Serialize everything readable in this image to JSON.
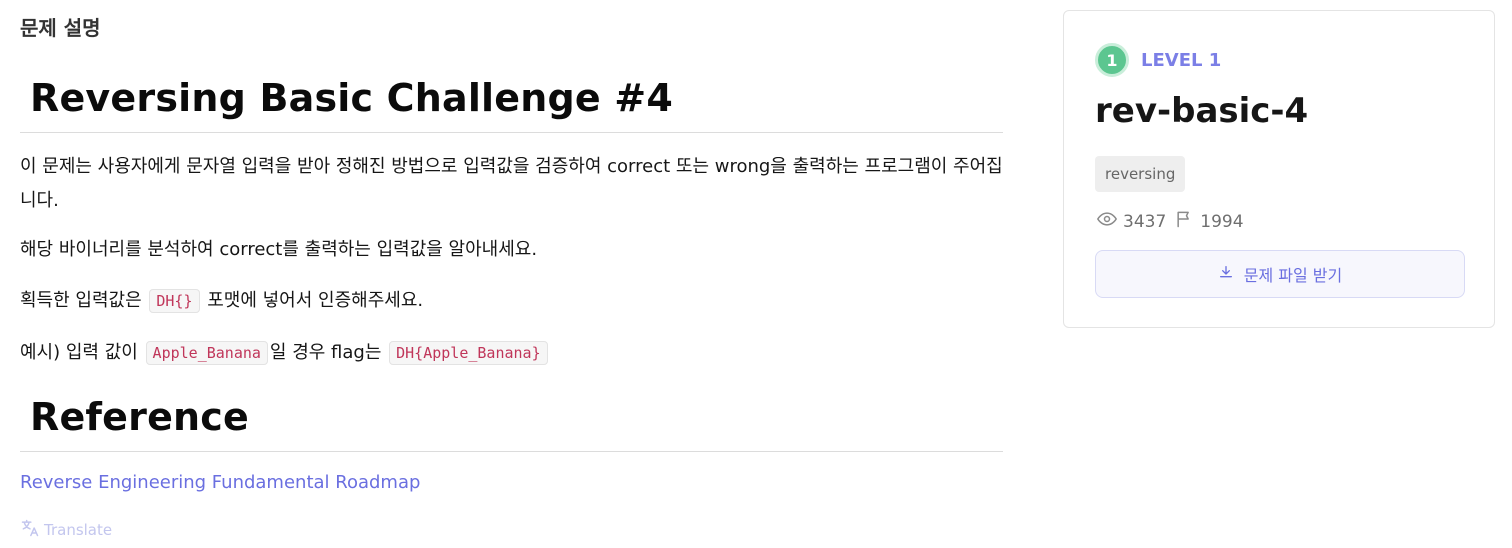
{
  "section": {
    "label": "문제 설명"
  },
  "content": {
    "title": "Reversing Basic Challenge #4",
    "p1": "이 문제는 사용자에게 문자열 입력을 받아 정해진 방법으로 입력값을 검증하여 correct 또는 wrong을 출력하는 프로그램이 주어집니다.",
    "p2": "해당 바이너리를 분석하여 correct를 출력하는 입력값을 알아내세요.",
    "p3_before": "획득한 입력값은 ",
    "p3_code": "DH{}",
    "p3_after": " 포맷에 넣어서 인증해주세요.",
    "p4_before": "예시) 입력 값이 ",
    "p4_code1": "Apple_Banana",
    "p4_mid": "일 경우 flag는 ",
    "p4_code2": "DH{Apple_Banana}",
    "reference_heading": "Reference",
    "reference_link": "Reverse Engineering Fundamental Roadmap",
    "translate_label": "Translate"
  },
  "card": {
    "level_number": "1",
    "level_label": "LEVEL 1",
    "title": "rev-basic-4",
    "tag": "reversing",
    "views": "3437",
    "solves": "1994",
    "download_label": "문제 파일 받기"
  },
  "colors": {
    "accent": "#6a6fe0",
    "level_green": "#5cc690",
    "code_red": "#c0365a"
  },
  "icons": [
    "translate-icon",
    "eye-icon",
    "flag-icon",
    "download-icon"
  ]
}
